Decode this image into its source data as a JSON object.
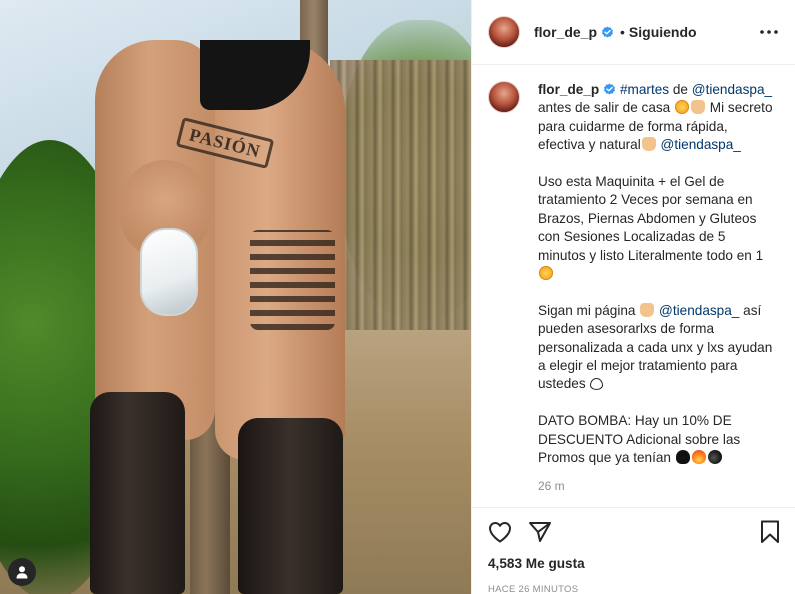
{
  "post": {
    "photo_word": "PASIÓN",
    "username": "flor_de_p",
    "separator": "•",
    "follow_status": "Siguiendo"
  },
  "caption": {
    "username": "flor_de_p",
    "hashtag": "#martes",
    "text_de": " de ",
    "mention": "@tiendaspa_",
    "line1_rest": " antes de salir de casa ",
    "line1_cont": " Mi secreto para cuidarme de forma rápida, efectiva y natural",
    "mention2": "@tiendaspa_",
    "para2": "Uso esta Maquinita + el Gel de tratamiento 2 Veces por semana en Brazos, Piernas Abdomen y Gluteos con Sesiones Localizadas de 5 minutos y listo Literalmente todo en 1 ",
    "para3_a": "Sigan mi página ",
    "para3_mention": "@tiendaspa_",
    "para3_b": " así pueden asesorarlxs de forma personalizada a cada unx y lxs ayudan a elegir el mejor tratamiento para ustedes ",
    "para4": "DATO BOMBA: Hay un 10% DE DESCUENTO Adicional sobre las Promos que ya tenían "
  },
  "timestamp": "26 m",
  "likes": "4,583 Me gusta",
  "posted_ago": "HACE 26 MINUTOS",
  "icons": {
    "heart": "heart-icon",
    "share": "paper-plane-icon",
    "save": "bookmark-icon",
    "more": "more-options-icon",
    "verified": "verified-badge-icon",
    "user_tag": "user-tag-icon"
  },
  "colors": {
    "text": "#262626",
    "muted": "#8e8e8e",
    "link": "#00376b",
    "verified": "#3897f0",
    "border": "#efefef"
  }
}
